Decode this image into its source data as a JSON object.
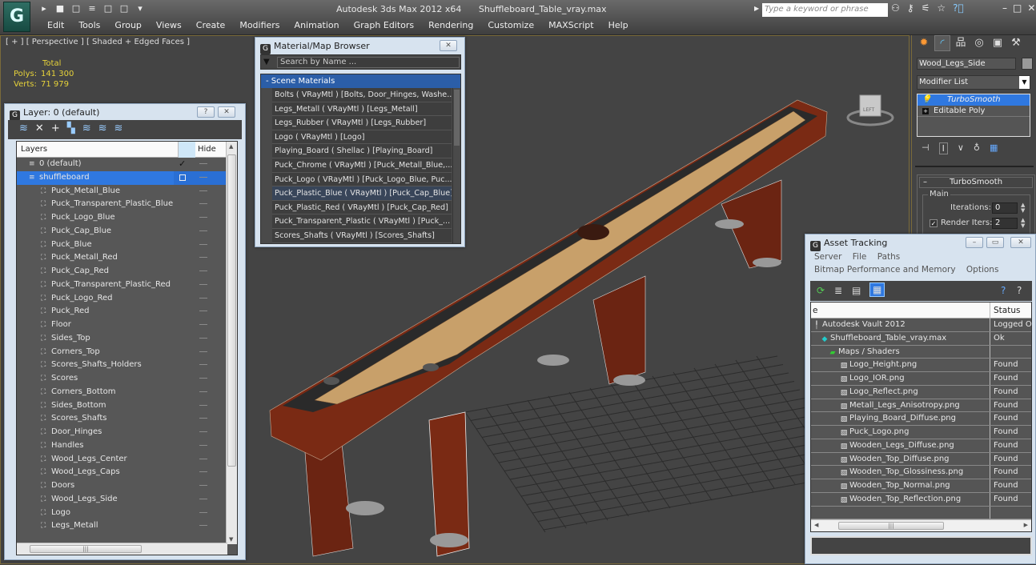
{
  "app": {
    "title": "Autodesk 3ds Max  2012 x64",
    "file": "Shuffleboard_Table_vray.max",
    "logo_icon": "3dsmax-logo-icon",
    "quick_access": [
      "open-icon",
      "save-icon",
      "new-icon",
      "project-icon",
      "window-icon",
      "window2-icon",
      "dropdown-icon"
    ],
    "menu": [
      "Edit",
      "Tools",
      "Group",
      "Views",
      "Create",
      "Modifiers",
      "Animation",
      "Graph Editors",
      "Rendering",
      "Customize",
      "MAXScript",
      "Help"
    ],
    "search_placeholder": "Type a keyword or phrase",
    "right_tools": [
      "binoculars-icon",
      "key-icon",
      "satellite-icon",
      "star-icon",
      "help-icon"
    ]
  },
  "viewport": {
    "label": "[ + ] [ Perspective ] [ Shaded + Edged Faces ]",
    "stats": {
      "header": "Total",
      "polys_label": "Polys:",
      "polys": "141 300",
      "verts_label": "Verts:",
      "verts": "71 979"
    },
    "viewcube_face": "LEFT"
  },
  "layer_panel": {
    "title": "Layer: 0 (default)",
    "help": "?",
    "close": "✕",
    "toolbar": [
      "new-layer-icon",
      "delete-icon",
      "add-icon",
      "select-icon",
      "highlight-icon",
      "hide-icon",
      "freeze-icon"
    ],
    "columns": {
      "name": "Layers",
      "hide": "Hide"
    },
    "layers": [
      {
        "name": "0 (default)",
        "type": "layer",
        "checked": true
      },
      {
        "name": "shuffleboard",
        "type": "layer",
        "selected": true
      }
    ],
    "objects": [
      "Puck_Metall_Blue",
      "Puck_Transparent_Plastic_Blue",
      "Puck_Logo_Blue",
      "Puck_Cap_Blue",
      "Puck_Blue",
      "Puck_Metall_Red",
      "Puck_Cap_Red",
      "Puck_Transparent_Plastic_Red",
      "Puck_Logo_Red",
      "Puck_Red",
      "Floor",
      "Sides_Top",
      "Corners_Top",
      "Scores_Shafts_Holders",
      "Scores",
      "Corners_Bottom",
      "Sides_Bottom",
      "Scores_Shafts",
      "Door_Hinges",
      "Handles",
      "Wood_Legs_Center",
      "Wood_Legs_Caps",
      "Doors",
      "Wood_Legs_Side",
      "Logo",
      "Legs_Metall"
    ]
  },
  "material_browser": {
    "title": "Material/Map Browser",
    "close": "✕",
    "search_placeholder": "Search by Name ...",
    "group": "- Scene Materials",
    "items": [
      "Bolts  ( VRayMtl ) [Bolts, Door_Hinges, Washe...",
      "Legs_Metall  ( VRayMtl ) [Legs_Metall]",
      "Legs_Rubber  ( VRayMtl ) [Legs_Rubber]",
      "Logo  ( VRayMtl ) [Logo]",
      "Playing_Board  ( Shellac ) [Playing_Board]",
      "Puck_Chrome  ( VRayMtl ) [Puck_Metall_Blue,...",
      "Puck_Logo  ( VRayMtl ) [Puck_Logo_Blue, Puc...",
      "Puck_Plastic_Blue  ( VRayMtl ) [Puck_Cap_Blue]",
      "Puck_Plastic_Red  ( VRayMtl ) [Puck_Cap_Red]",
      "Puck_Transparent_Plastic  ( VRayMtl ) [Puck_...",
      "Scores_Shafts  ( VRayMtl ) [Scores_Shafts]"
    ],
    "highlighted_index": 7
  },
  "command_panel": {
    "tabs": [
      "create-icon",
      "modify-icon",
      "hierarchy-icon",
      "motion-icon",
      "display-icon",
      "utilities-icon"
    ],
    "object_name": "Wood_Legs_Side",
    "modifier_list": "Modifier List",
    "stack": [
      {
        "name": "TurboSmooth",
        "active": true
      },
      {
        "name": "Editable Poly"
      }
    ],
    "stack_buttons": [
      "pin-stack-icon",
      "show-end-result-icon",
      "make-unique-icon",
      "remove-modifier-icon",
      "configure-sets-icon"
    ],
    "rollout": {
      "title": "TurboSmooth",
      "group": "Main",
      "iterations_label": "Iterations:",
      "iterations": "0",
      "render_iters_label": "Render Iters:",
      "render_iters": "2",
      "render_iters_checked": true
    }
  },
  "asset_tracking": {
    "title": "Asset Tracking",
    "menu_row1": [
      "Server",
      "File",
      "Paths"
    ],
    "menu_row2": [
      "Bitmap Performance and Memory",
      "Options"
    ],
    "toolbar": [
      "refresh-icon",
      "list-icon",
      "thumbnail-icon",
      "table-view-icon",
      "help-icon",
      "info-icon"
    ],
    "columns": {
      "name": "e",
      "status": "Status"
    },
    "rows": [
      {
        "name": "Autodesk Vault 2012",
        "status": "Logged O",
        "level": 0,
        "icon": "vault-icon"
      },
      {
        "name": "Shuffleboard_Table_vray.max",
        "status": "Ok",
        "level": 1,
        "icon": "max-file-icon"
      },
      {
        "name": "Maps / Shaders",
        "status": "",
        "level": 2,
        "icon": "maps-icon"
      },
      {
        "name": "Logo_Height.png",
        "status": "Found",
        "level": 3,
        "icon": "bitmap-icon"
      },
      {
        "name": "Logo_IOR.png",
        "status": "Found",
        "level": 3,
        "icon": "bitmap-icon"
      },
      {
        "name": "Logo_Reflect.png",
        "status": "Found",
        "level": 3,
        "icon": "bitmap-icon"
      },
      {
        "name": "Metall_Legs_Anisotropy.png",
        "status": "Found",
        "level": 3,
        "icon": "bitmap-icon"
      },
      {
        "name": "Playing_Board_Diffuse.png",
        "status": "Found",
        "level": 3,
        "icon": "bitmap-icon"
      },
      {
        "name": "Puck_Logo.png",
        "status": "Found",
        "level": 3,
        "icon": "bitmap-icon"
      },
      {
        "name": "Wooden_Legs_Diffuse.png",
        "status": "Found",
        "level": 3,
        "icon": "bitmap-icon"
      },
      {
        "name": "Wooden_Top_Diffuse.png",
        "status": "Found",
        "level": 3,
        "icon": "bitmap-icon"
      },
      {
        "name": "Wooden_Top_Glossiness.png",
        "status": "Found",
        "level": 3,
        "icon": "bitmap-icon"
      },
      {
        "name": "Wooden_Top_Normal.png",
        "status": "Found",
        "level": 3,
        "icon": "bitmap-icon"
      },
      {
        "name": "Wooden_Top_Reflection.png",
        "status": "Found",
        "level": 3,
        "icon": "bitmap-icon"
      }
    ]
  },
  "colors": {
    "accent": "#2f78e0",
    "stats": "#e6d23a",
    "wood_top": "#c8a06a",
    "wood_side": "#7a2a14"
  }
}
